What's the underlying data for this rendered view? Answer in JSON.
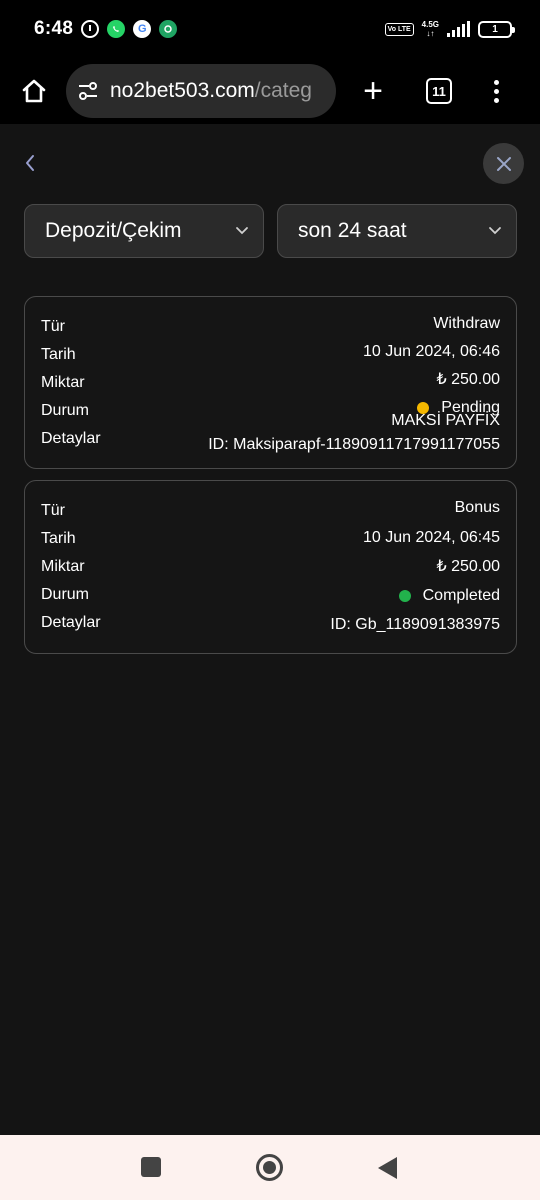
{
  "status_bar": {
    "time": "6:48",
    "network": "4.5G",
    "volte": "Vo LTE",
    "battery": "1",
    "google_letter": "G"
  },
  "browser": {
    "url_main": "no2bet503.com",
    "url_rest": "/categ",
    "tab_count": "11",
    "new_tab_glyph": "+"
  },
  "filters": {
    "type_select": "Depozit/Çekim",
    "period_select": "son 24 saat"
  },
  "labels": {
    "type": "Tür",
    "date": "Tarih",
    "amount": "Miktar",
    "status": "Durum",
    "details": "Detaylar"
  },
  "transactions": [
    {
      "type": "Withdraw",
      "date": "10 Jun 2024, 06:46",
      "amount": "₺ 250.00",
      "status": "Pending",
      "status_color": "#f5b800",
      "provider": "MAKSİ PAYFİX",
      "id": "ID: Maksiparapf-11890911717991177055"
    },
    {
      "type": "Bonus",
      "date": "10 Jun 2024, 06:45",
      "amount": "₺ 250.00",
      "status": "Completed",
      "status_color": "#22b24c",
      "id": "ID: Gb_1189091383975"
    }
  ],
  "colors": {
    "background": "#141414",
    "card_border": "#4a4a4a",
    "select_bg": "#2a2a2a"
  }
}
